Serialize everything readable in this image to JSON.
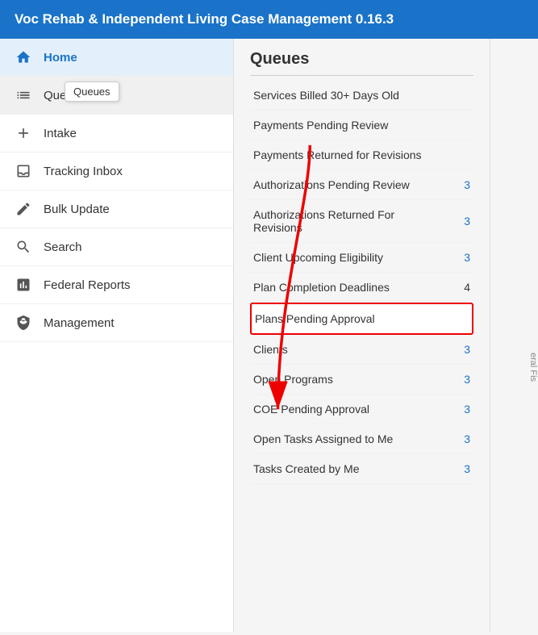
{
  "app": {
    "title": "Voc Rehab & Independent Living Case Management 0.16.3"
  },
  "sidebar": {
    "items": [
      {
        "id": "home",
        "label": "Home",
        "icon": "🏠",
        "active": true
      },
      {
        "id": "queues",
        "label": "Queues",
        "icon": "☰",
        "highlighted": true
      },
      {
        "id": "intake",
        "label": "Intake",
        "icon": "＋"
      },
      {
        "id": "tracking-inbox",
        "label": "Tracking Inbox",
        "icon": "▣"
      },
      {
        "id": "bulk-update",
        "label": "Bulk Update",
        "icon": "✏"
      },
      {
        "id": "search",
        "label": "Search",
        "icon": "🔍"
      },
      {
        "id": "federal-reports",
        "label": "Federal Reports",
        "icon": "📊"
      },
      {
        "id": "management",
        "label": "Management",
        "icon": "🛡"
      }
    ],
    "tooltip": "Queues"
  },
  "queues": {
    "title": "Queues",
    "items": [
      {
        "id": "services-billed",
        "label": "Services Billed 30+ Days Old",
        "count": "",
        "countColor": ""
      },
      {
        "id": "payments-pending",
        "label": "Payments Pending Review",
        "count": "",
        "countColor": ""
      },
      {
        "id": "payments-returned",
        "label": "Payments Returned for Revisions",
        "count": "",
        "countColor": ""
      },
      {
        "id": "auth-pending",
        "label": "Authorizations Pending Review",
        "count": "3",
        "countColor": "blue"
      },
      {
        "id": "auth-returned",
        "label": "Authorizations Returned For Revisions",
        "count": "3",
        "countColor": "blue"
      },
      {
        "id": "client-eligibility",
        "label": "Client Upcoming Eligibility",
        "count": "3",
        "countColor": "blue"
      },
      {
        "id": "plan-completion",
        "label": "Plan Completion Deadlines",
        "count": "4",
        "countColor": "black"
      },
      {
        "id": "plans-pending",
        "label": "Plans Pending Approval",
        "count": "",
        "countColor": "",
        "highlighted": true
      },
      {
        "id": "clients",
        "label": "Clients",
        "count": "3",
        "countColor": "blue"
      },
      {
        "id": "open-programs",
        "label": "Open Programs",
        "count": "3",
        "countColor": "blue"
      },
      {
        "id": "coe-pending",
        "label": "COE Pending Approval",
        "count": "3",
        "countColor": "blue"
      },
      {
        "id": "open-tasks",
        "label": "Open Tasks Assigned to Me",
        "count": "3",
        "countColor": "blue"
      },
      {
        "id": "tasks-created",
        "label": "Tasks Created by Me",
        "count": "3",
        "countColor": "blue"
      }
    ]
  },
  "right_panel": {
    "label": "eral Fis"
  }
}
